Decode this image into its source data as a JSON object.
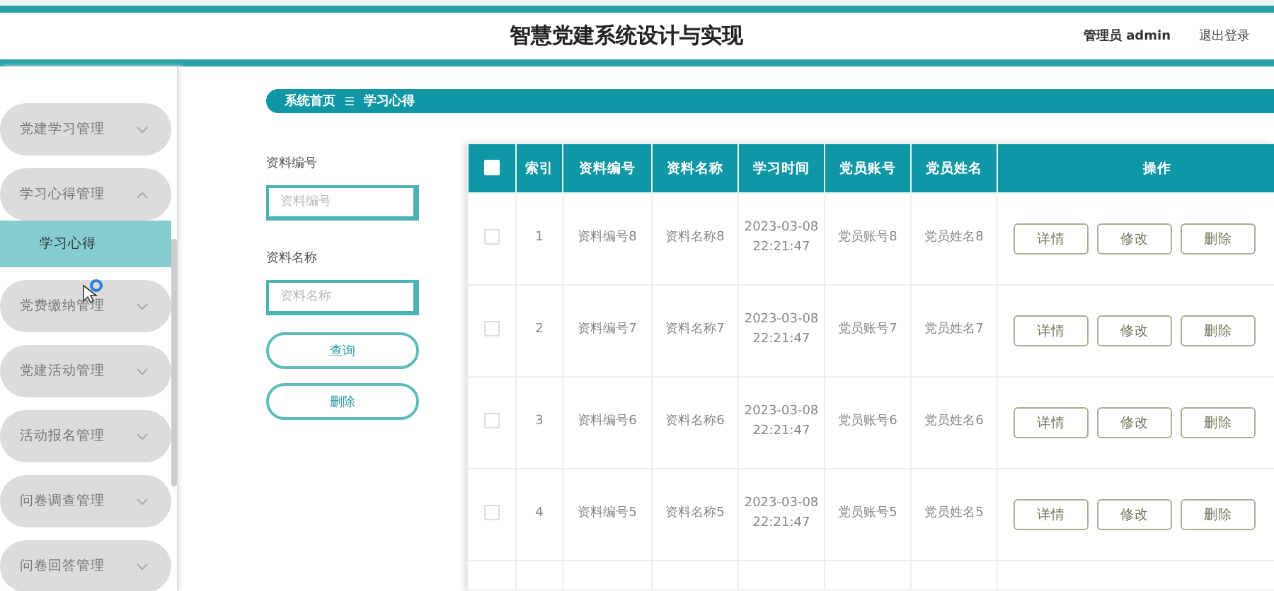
{
  "header": {
    "title": "智慧党建系统设计与实现",
    "user": "管理员 admin",
    "logout": "退出登录"
  },
  "sidebar": {
    "items": [
      {
        "label": "党建学习管理",
        "expanded": false
      },
      {
        "label": "学习心得管理",
        "expanded": true,
        "children": [
          {
            "label": "学习心得",
            "selected": true
          }
        ]
      },
      {
        "label": "党费缴纳管理",
        "expanded": false
      },
      {
        "label": "党建活动管理",
        "expanded": false
      },
      {
        "label": "活动报名管理",
        "expanded": false
      },
      {
        "label": "问卷调查管理",
        "expanded": false
      },
      {
        "label": "问卷回答管理",
        "expanded": false
      }
    ]
  },
  "breadcrumb": [
    "系统首页",
    "学习心得"
  ],
  "search": {
    "fields": [
      {
        "label": "资料编号",
        "placeholder": "资料编号"
      },
      {
        "label": "资料名称",
        "placeholder": "资料名称"
      }
    ],
    "buttons": [
      "查询",
      "删除"
    ]
  },
  "table": {
    "select_all": {
      "checked": false
    },
    "columns": [
      "索引",
      "资料编号",
      "资料名称",
      "学习时间",
      "党员账号",
      "党员姓名",
      "操作"
    ],
    "rows": [
      {
        "checked": false,
        "cells": [
          "1",
          "资料编号8",
          "资料名称8",
          "2023-03-08 22:21:47",
          "党员账号8",
          "党员姓名8"
        ],
        "actions": [
          "详情",
          "修改",
          "删除"
        ]
      },
      {
        "checked": false,
        "cells": [
          "2",
          "资料编号7",
          "资料名称7",
          "2023-03-08 22:21:47",
          "党员账号7",
          "党员姓名7"
        ],
        "actions": [
          "详情",
          "修改",
          "删除"
        ]
      },
      {
        "checked": false,
        "cells": [
          "3",
          "资料编号6",
          "资料名称6",
          "2023-03-08 22:21:47",
          "党员账号6",
          "党员姓名6"
        ],
        "actions": [
          "详情",
          "修改",
          "删除"
        ]
      },
      {
        "checked": false,
        "cells": [
          "4",
          "资料编号5",
          "资料名称5",
          "2023-03-08 22:21:47",
          "党员账号5",
          "党员姓名5"
        ],
        "actions": [
          "详情",
          "修改",
          "删除"
        ]
      }
    ]
  }
}
